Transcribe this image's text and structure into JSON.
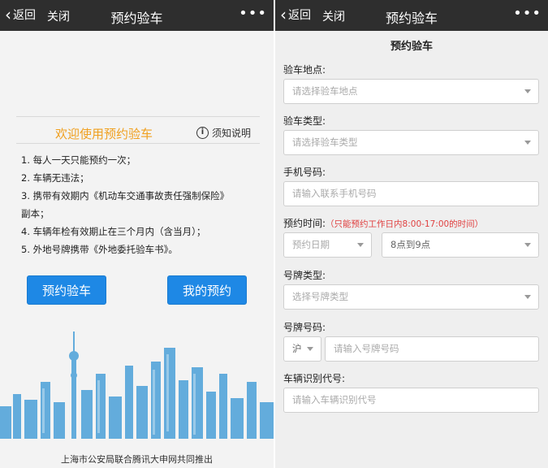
{
  "left": {
    "topbar": {
      "back": "返回",
      "close": "关闭",
      "title": "预约验车",
      "more": "•••"
    },
    "welcome": "欢迎使用预约验车",
    "notice": "须知说明",
    "rules": [
      "1. 每人一天只能预约一次；",
      "2. 车辆无违法；",
      "3. 携带有效期内《机动车交通事故责任强制保险》",
      "副本；",
      "4. 车辆年检有效期止在三个月内（含当月）；",
      "5. 外地号牌携带《外地委托验车书》。"
    ],
    "buttons": {
      "book": "预约验车",
      "mine": "我的预约"
    },
    "footer": "上海市公安局联合腾讯大申网共同推出"
  },
  "right": {
    "topbar": {
      "back": "返回",
      "close": "关闭",
      "title": "预约验车",
      "more": "•••"
    },
    "form_title": "预约验车",
    "location": {
      "label": "验车地点:",
      "placeholder": "请选择验车地点"
    },
    "type": {
      "label": "验车类型:",
      "placeholder": "请选择验车类型"
    },
    "phone": {
      "label": "手机号码:",
      "placeholder": "请输入联系手机号码"
    },
    "time": {
      "label": "预约时间:",
      "hint": "（只能预约工作日内8:00-17:00的时间）",
      "date_placeholder": "预约日期",
      "slot_value": "8点到9点"
    },
    "plate_type": {
      "label": "号牌类型:",
      "placeholder": "选择号牌类型"
    },
    "plate_no": {
      "label": "号牌号码:",
      "prefix": "沪",
      "placeholder": "请输入号牌号码"
    },
    "vin": {
      "label": "车辆识别代号:",
      "placeholder": "请输入车辆识别代号"
    }
  },
  "colors": {
    "topbar": "#2e2e2e",
    "accent_blue": "#1e88e5",
    "welcome_orange": "#f0a020",
    "hint_red": "#e04040",
    "skyline_blue": "#4aa0d8"
  },
  "icons": [
    "back-chevron-icon",
    "more-dots-icon",
    "info-icon",
    "dropdown-arrow-icon"
  ]
}
